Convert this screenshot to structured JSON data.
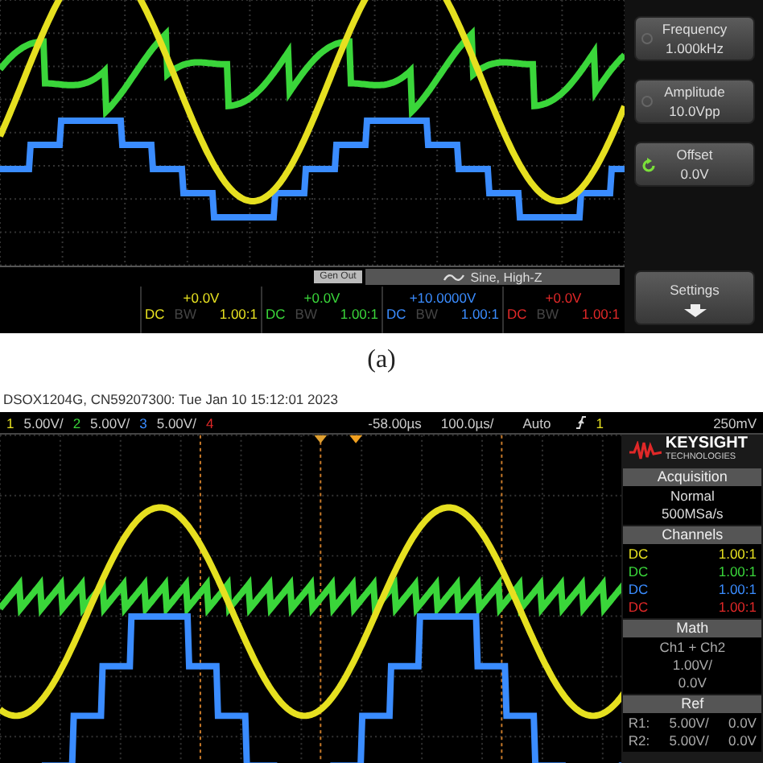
{
  "scope_a": {
    "softkeys": [
      {
        "kind": "plain",
        "label": "Frequency",
        "value": "1.000kHz"
      },
      {
        "kind": "plain",
        "label": "Amplitude",
        "value": "10.0Vpp"
      },
      {
        "kind": "knob",
        "label": "Offset",
        "value": "0.0V"
      },
      {
        "kind": "arrow",
        "label": "Settings"
      }
    ],
    "generator": {
      "badge": "Gen Out",
      "waveform": "Sine, High-Z"
    },
    "channels": [
      {
        "offset": "+0.0V",
        "coupling": "DC",
        "bandwidth": "BW",
        "probe": "1.00:1",
        "color": "#e6e020"
      },
      {
        "offset": "+0.0V",
        "coupling": "DC",
        "bandwidth": "BW",
        "probe": "1.00:1",
        "color": "#3ad63a"
      },
      {
        "offset": "+10.0000V",
        "coupling": "DC",
        "bandwidth": "BW",
        "probe": "1.00:1",
        "color": "#3a8cff"
      },
      {
        "offset": "+0.0V",
        "coupling": "DC",
        "bandwidth": "BW",
        "probe": "1.00:1",
        "color": "#e02828"
      }
    ]
  },
  "caption": "(a)",
  "scope_b": {
    "header": "DSOX1204G, CN59207300: Tue Jan 10 15:12:01 2023",
    "channels": [
      {
        "number": "1",
        "scale": "5.00V/",
        "color": "#e6e020"
      },
      {
        "number": "2",
        "scale": "5.00V/",
        "color": "#3ad63a"
      },
      {
        "number": "3",
        "scale": "5.00V/",
        "color": "#3a8cff"
      },
      {
        "number": "4",
        "color": "#e02828"
      }
    ],
    "timebase": {
      "delay": "-58.00µs",
      "scale": "100.0µs/"
    },
    "trigger": {
      "mode": "Auto",
      "source": "1",
      "level": "250mV"
    },
    "logo": {
      "name": "KEYSIGHT",
      "tagline": "TECHNOLOGIES"
    },
    "acquisition": {
      "title": "Acquisition",
      "lines": [
        "Normal",
        "500MSa/s"
      ]
    },
    "channel_list": {
      "title": "Channels",
      "rows": [
        {
          "coupling": "DC",
          "probe": "1.00:1",
          "color": "#e6e020"
        },
        {
          "coupling": "DC",
          "probe": "1.00:1",
          "color": "#3ad63a"
        },
        {
          "coupling": "DC",
          "probe": "1.00:1",
          "color": "#3a8cff"
        },
        {
          "coupling": "DC",
          "probe": "1.00:1",
          "color": "#e02828"
        }
      ]
    },
    "math": {
      "title": "Math",
      "lines": [
        "Ch1 + Ch2",
        "1.00V/",
        "0.0V"
      ]
    },
    "ref": {
      "title": "Ref",
      "rows": [
        {
          "name": "R1:",
          "scale": "5.00V/",
          "offset": "0.0V"
        },
        {
          "name": "R2:",
          "scale": "5.00V/",
          "offset": "0.0V"
        }
      ]
    }
  }
}
